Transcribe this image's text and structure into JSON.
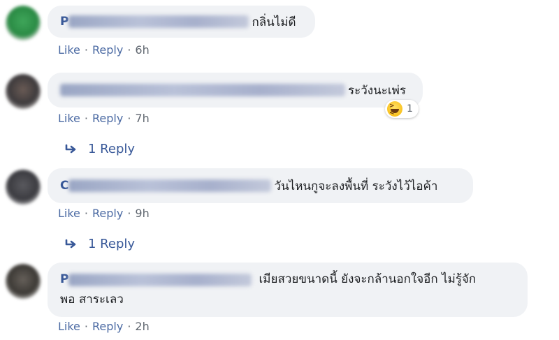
{
  "comments": [
    {
      "initial": "P",
      "text": "กลิ่นไม่ดี",
      "actions": {
        "like": "Like",
        "sep": "·",
        "reply": "Reply",
        "time": "6h"
      }
    },
    {
      "initial": "",
      "text": "ระวังนะเพ่ร",
      "reaction_count": "1",
      "actions": {
        "like": "Like",
        "sep": "·",
        "reply": "Reply",
        "time": "7h"
      },
      "replies_label": "1 Reply"
    },
    {
      "initial": "C",
      "text": "วันไหนกูจะลงพื้นที่ ระวังไว้ไอค้า",
      "actions": {
        "like": "Like",
        "sep": "·",
        "reply": "Reply",
        "time": "9h"
      },
      "replies_label": "1 Reply"
    },
    {
      "initial": "P",
      "text_line1": "เมียสวยขนาดนี้ ยังจะกล้านอกใจอีก ไม่รู้จัก",
      "text_line2": "พอ สาระเลว",
      "actions": {
        "like": "Like",
        "sep": "·",
        "reply": "Reply",
        "time": "2h"
      }
    }
  ],
  "colors": {
    "bubble": "#f0f2f5",
    "link": "#385898",
    "meta": "#606770"
  }
}
